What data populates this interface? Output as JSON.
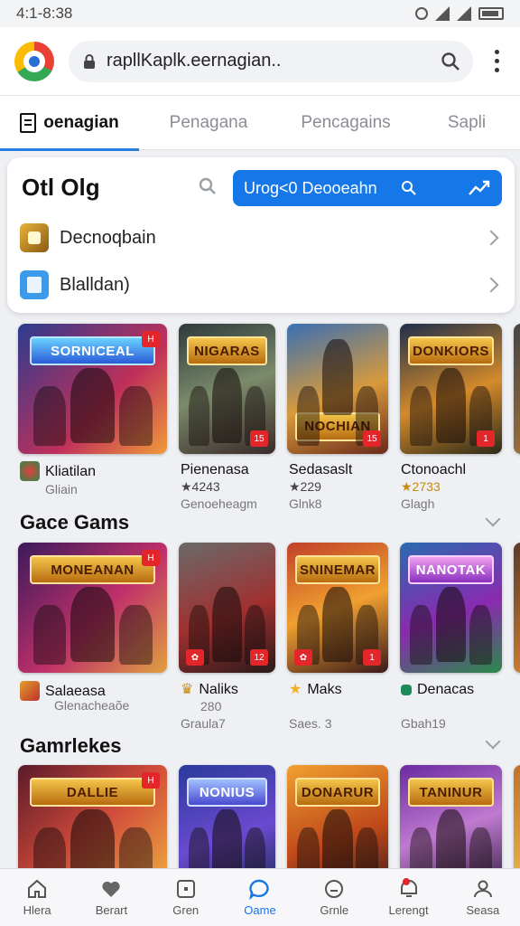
{
  "status_bar": {
    "time": "4:1-8:38"
  },
  "browser": {
    "url": "rapllKaplk.eernagian..",
    "colors": {
      "accent": "#1677e8"
    }
  },
  "tabs": [
    {
      "label": "oenagian",
      "active": true
    },
    {
      "label": "Penagana",
      "active": false
    },
    {
      "label": "Pencagains",
      "active": false
    },
    {
      "label": "Sapli",
      "active": false
    }
  ],
  "search_card": {
    "title": "Otl Olg",
    "button_text": "Urog<0 Deooeahn",
    "rows": [
      {
        "label": "Decnoqbain",
        "icon": "trophy-icon"
      },
      {
        "label": "Blalldan)",
        "icon": "bin-icon"
      }
    ]
  },
  "sections": [
    {
      "title": "",
      "games": [
        {
          "name": "Kliatilan",
          "line2": "Gliain",
          "line3": "",
          "banner": "SORNICEAL",
          "icon": "game-badge-icon"
        },
        {
          "name": "Pienenasa",
          "line2": "★4243",
          "line3": "Genoeheagm",
          "banner": "NIGARAS"
        },
        {
          "name": "Sedasaslt",
          "line2": "★229",
          "line3": "Glnk8",
          "banner": "NOCHIAN"
        },
        {
          "name": "Ctonoachl",
          "line2": "★2733",
          "line3": "Glagh",
          "banner": "DONKIORS"
        }
      ]
    },
    {
      "title": "Gace Gams",
      "games": [
        {
          "name": "Salaeasa",
          "line2": "Glenacheaõe",
          "line3": "",
          "banner": "MONEANAN"
        },
        {
          "name": "Naliks",
          "line2": "280",
          "line3": "Graula7",
          "banner": ""
        },
        {
          "name": "Maks",
          "line2": "",
          "line3": "Saes. 3",
          "banner": "SNINEMAR"
        },
        {
          "name": "Denacas",
          "line2": "",
          "line3": "Gbah19",
          "banner": "NANOTAK"
        }
      ]
    },
    {
      "title": "Gamrlekes",
      "games": [
        {
          "banner": "DALLIE"
        },
        {
          "banner": "NONIUS"
        },
        {
          "banner": "DONARUR"
        },
        {
          "banner": "TANINUR"
        }
      ]
    }
  ],
  "bottom_nav": [
    {
      "label": "Hlera",
      "icon": "home-icon",
      "active": false
    },
    {
      "label": "Berart",
      "icon": "heart-icon",
      "active": false
    },
    {
      "label": "Gren",
      "icon": "square-icon",
      "active": false
    },
    {
      "label": "Oame",
      "icon": "chat-icon",
      "active": true
    },
    {
      "label": "Grnle",
      "icon": "smile-icon",
      "active": false
    },
    {
      "label": "Lerengt",
      "icon": "notify-icon",
      "active": false
    },
    {
      "label": "Seasa",
      "icon": "person-icon",
      "active": false
    }
  ]
}
